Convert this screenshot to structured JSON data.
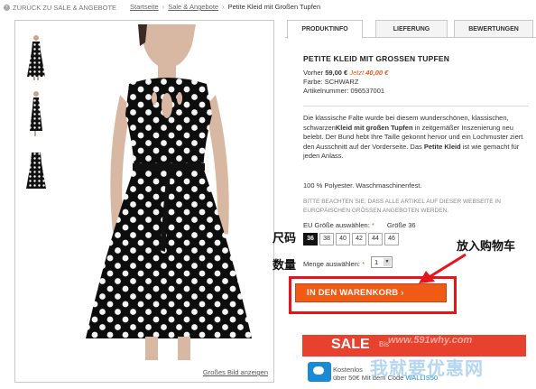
{
  "topbar": {
    "back_label": "ZURÜCK ZU SALE & ANGEBOTE",
    "breadcrumb": [
      "Startseite",
      "Sale & Angebote",
      "Petite Kleid mit Großen Tupfen"
    ]
  },
  "gallery": {
    "big_image_link": "Großes Bild anzeigen"
  },
  "tabs": [
    {
      "label": "PRODUKTINFO",
      "active": true
    },
    {
      "label": "LIEFERUNG",
      "active": false
    },
    {
      "label": "BEWERTUNGEN",
      "active": false
    }
  ],
  "product": {
    "title": "PETITE KLEID MIT GROSSEN TUPFEN",
    "old_price_label": "Vorher",
    "old_price": "59,00 €",
    "new_price_label": "Jetzt",
    "new_price": "40,00 €",
    "color_line": "Farbe: SCHWARZ",
    "article_line": "Artikelnummer: 096537001",
    "description_parts": [
      "Die klassische Falte wurde bei diesem wunderschönen, klassischen, schwarzen",
      "Kleid mit großen Tupfen",
      " in zeitgemäßer Inszenierung neu belebt. Der Bund hebt Ihre Taille gekonnt hervor und ein Lochmuster ziert den Ausschnitt auf der Vorderseite. Das ",
      "Petite Kleid",
      " ist wie gemacht für jeden Anlass."
    ],
    "material": "100 % Polyester. Waschmaschinenfest.",
    "note": "BITTE BEACHTEN SIE, DASS ALLE ARTIKEL AUF DIESER WEBSEITE IN EUROPÄISCHEN GRÖSSEN ANGEBOTEN WERDEN.",
    "size_label": "EU Größe auswählen:",
    "size_required": "*",
    "size_chosen": "Größe 36",
    "sizes": [
      "36",
      "38",
      "40",
      "42",
      "44",
      "46"
    ],
    "selected_size": "36",
    "qty_label": "Menge auswählen:",
    "qty_required": "*",
    "qty_value": "1",
    "cart_button": "IN DEN WARENKORB ›"
  },
  "annotations": {
    "size": "尺码",
    "quantity": "数量",
    "add_to_cart": "放入购物车"
  },
  "promo": {
    "sale": "SALE",
    "sale_sub": "Bis",
    "ship_line1": "Kostenlos",
    "ship_line2_prefix": "über 50€ Mit dem Code",
    "ship_code": "WALLIS50"
  },
  "watermark": {
    "url": "www.591why.com",
    "text": "我就要优惠网"
  },
  "colors": {
    "accent": "#f05a14",
    "annotation_red": "#e8141b",
    "price_orange": "#e8581b",
    "sale_red": "#e8412d",
    "ship_blue": "#1a8ad6"
  }
}
